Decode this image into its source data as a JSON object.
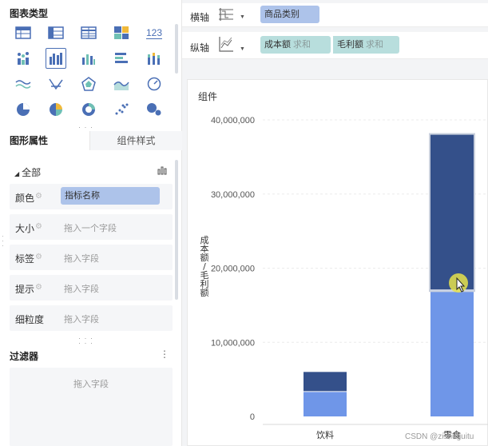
{
  "left_panel": {
    "chart_types_title": "图表类型",
    "chart_types": [
      {
        "name": "table-icon"
      },
      {
        "name": "crosstab-icon"
      },
      {
        "name": "detail-table-icon"
      },
      {
        "name": "treemap-icon"
      },
      {
        "name": "kpi-number-icon",
        "label": "123"
      },
      {
        "name": "dot-bar-icon"
      },
      {
        "name": "grouped-column-icon",
        "selected": true
      },
      {
        "name": "column-icon"
      },
      {
        "name": "horizontal-bar-icon"
      },
      {
        "name": "stacked-column-icon"
      },
      {
        "name": "wave-line-icon"
      },
      {
        "name": "radar-line-icon"
      },
      {
        "name": "radar-icon"
      },
      {
        "name": "area-icon"
      },
      {
        "name": "gauge-icon"
      },
      {
        "name": "pie-icon"
      },
      {
        "name": "rose-pie-icon"
      },
      {
        "name": "donut-icon"
      },
      {
        "name": "scatter-icon"
      },
      {
        "name": "bubble-icon"
      }
    ],
    "tabs": {
      "graphic_properties": "图形属性",
      "component_style": "组件样式"
    },
    "group_label": "全部",
    "attributes": [
      {
        "label": "颜色",
        "value": "指标名称",
        "has_value": true
      },
      {
        "label": "大小",
        "placeholder": "拖入一个字段"
      },
      {
        "label": "标签",
        "placeholder": "拖入字段"
      },
      {
        "label": "提示",
        "placeholder": "拖入字段"
      },
      {
        "label": "细粒度",
        "placeholder": "拖入字段"
      }
    ],
    "filter_title": "过滤器",
    "filter_more": "⋮",
    "filter_placeholder": "拖入字段"
  },
  "shelves": {
    "x_axis": {
      "label": "横轴",
      "pill": "商品类别"
    },
    "y_axis": {
      "label": "纵轴",
      "pills": [
        {
          "name": "成本额",
          "agg": "求和"
        },
        {
          "name": "毛利额",
          "agg": "求和"
        }
      ]
    }
  },
  "card": {
    "title": "组件"
  },
  "chart_data": {
    "type": "bar",
    "stacked": true,
    "categories": [
      "饮料",
      "零食"
    ],
    "series": [
      {
        "name": "成本额",
        "values": [
          3300000,
          17000000
        ],
        "color": "#6f96e8"
      },
      {
        "name": "毛利额",
        "values": [
          2700000,
          21000000
        ],
        "color": "#34508a"
      }
    ],
    "ylabel": "成本额/毛利额",
    "ylim": [
      0,
      40000000
    ],
    "yticks": [
      "0",
      "10,000,000",
      "20,000,000",
      "30,000,000",
      "40,000,000"
    ],
    "grid": true,
    "highlighted_category": "零食"
  },
  "watermark": "CSDN @zishuguitu"
}
